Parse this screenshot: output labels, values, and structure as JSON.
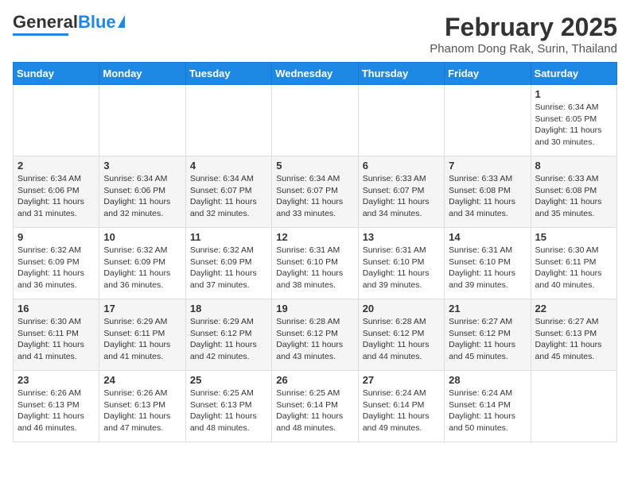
{
  "header": {
    "logo_line1": "General",
    "logo_line2": "Blue",
    "title": "February 2025",
    "subtitle": "Phanom Dong Rak, Surin, Thailand"
  },
  "weekdays": [
    "Sunday",
    "Monday",
    "Tuesday",
    "Wednesday",
    "Thursday",
    "Friday",
    "Saturday"
  ],
  "weeks": [
    [
      {
        "day": "",
        "info": ""
      },
      {
        "day": "",
        "info": ""
      },
      {
        "day": "",
        "info": ""
      },
      {
        "day": "",
        "info": ""
      },
      {
        "day": "",
        "info": ""
      },
      {
        "day": "",
        "info": ""
      },
      {
        "day": "1",
        "info": "Sunrise: 6:34 AM\nSunset: 6:05 PM\nDaylight: 11 hours and 30 minutes."
      }
    ],
    [
      {
        "day": "2",
        "info": "Sunrise: 6:34 AM\nSunset: 6:06 PM\nDaylight: 11 hours and 31 minutes."
      },
      {
        "day": "3",
        "info": "Sunrise: 6:34 AM\nSunset: 6:06 PM\nDaylight: 11 hours and 32 minutes."
      },
      {
        "day": "4",
        "info": "Sunrise: 6:34 AM\nSunset: 6:07 PM\nDaylight: 11 hours and 32 minutes."
      },
      {
        "day": "5",
        "info": "Sunrise: 6:34 AM\nSunset: 6:07 PM\nDaylight: 11 hours and 33 minutes."
      },
      {
        "day": "6",
        "info": "Sunrise: 6:33 AM\nSunset: 6:07 PM\nDaylight: 11 hours and 34 minutes."
      },
      {
        "day": "7",
        "info": "Sunrise: 6:33 AM\nSunset: 6:08 PM\nDaylight: 11 hours and 34 minutes."
      },
      {
        "day": "8",
        "info": "Sunrise: 6:33 AM\nSunset: 6:08 PM\nDaylight: 11 hours and 35 minutes."
      }
    ],
    [
      {
        "day": "9",
        "info": "Sunrise: 6:32 AM\nSunset: 6:09 PM\nDaylight: 11 hours and 36 minutes."
      },
      {
        "day": "10",
        "info": "Sunrise: 6:32 AM\nSunset: 6:09 PM\nDaylight: 11 hours and 36 minutes."
      },
      {
        "day": "11",
        "info": "Sunrise: 6:32 AM\nSunset: 6:09 PM\nDaylight: 11 hours and 37 minutes."
      },
      {
        "day": "12",
        "info": "Sunrise: 6:31 AM\nSunset: 6:10 PM\nDaylight: 11 hours and 38 minutes."
      },
      {
        "day": "13",
        "info": "Sunrise: 6:31 AM\nSunset: 6:10 PM\nDaylight: 11 hours and 39 minutes."
      },
      {
        "day": "14",
        "info": "Sunrise: 6:31 AM\nSunset: 6:10 PM\nDaylight: 11 hours and 39 minutes."
      },
      {
        "day": "15",
        "info": "Sunrise: 6:30 AM\nSunset: 6:11 PM\nDaylight: 11 hours and 40 minutes."
      }
    ],
    [
      {
        "day": "16",
        "info": "Sunrise: 6:30 AM\nSunset: 6:11 PM\nDaylight: 11 hours and 41 minutes."
      },
      {
        "day": "17",
        "info": "Sunrise: 6:29 AM\nSunset: 6:11 PM\nDaylight: 11 hours and 41 minutes."
      },
      {
        "day": "18",
        "info": "Sunrise: 6:29 AM\nSunset: 6:12 PM\nDaylight: 11 hours and 42 minutes."
      },
      {
        "day": "19",
        "info": "Sunrise: 6:28 AM\nSunset: 6:12 PM\nDaylight: 11 hours and 43 minutes."
      },
      {
        "day": "20",
        "info": "Sunrise: 6:28 AM\nSunset: 6:12 PM\nDaylight: 11 hours and 44 minutes."
      },
      {
        "day": "21",
        "info": "Sunrise: 6:27 AM\nSunset: 6:12 PM\nDaylight: 11 hours and 45 minutes."
      },
      {
        "day": "22",
        "info": "Sunrise: 6:27 AM\nSunset: 6:13 PM\nDaylight: 11 hours and 45 minutes."
      }
    ],
    [
      {
        "day": "23",
        "info": "Sunrise: 6:26 AM\nSunset: 6:13 PM\nDaylight: 11 hours and 46 minutes."
      },
      {
        "day": "24",
        "info": "Sunrise: 6:26 AM\nSunset: 6:13 PM\nDaylight: 11 hours and 47 minutes."
      },
      {
        "day": "25",
        "info": "Sunrise: 6:25 AM\nSunset: 6:13 PM\nDaylight: 11 hours and 48 minutes."
      },
      {
        "day": "26",
        "info": "Sunrise: 6:25 AM\nSunset: 6:14 PM\nDaylight: 11 hours and 48 minutes."
      },
      {
        "day": "27",
        "info": "Sunrise: 6:24 AM\nSunset: 6:14 PM\nDaylight: 11 hours and 49 minutes."
      },
      {
        "day": "28",
        "info": "Sunrise: 6:24 AM\nSunset: 6:14 PM\nDaylight: 11 hours and 50 minutes."
      },
      {
        "day": "",
        "info": ""
      }
    ]
  ]
}
